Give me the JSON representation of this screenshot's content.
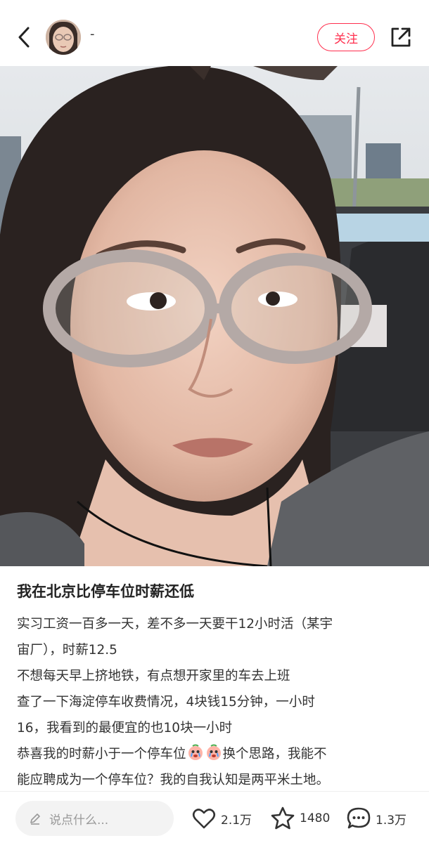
{
  "header": {
    "username": "-",
    "follow_label": "关注"
  },
  "post": {
    "title": "我在北京比停车位时薪还低",
    "lines": [
      "实习工资一百多一天，差不多一天要干12小时活（某宇",
      "宙厂），时薪12.5",
      "不想每天早上挤地铁，有点想开家里的车去上班",
      "查了一下海淀停车收费情况，4块钱15分钟，一小时",
      "16，我看到的最便宜的也10块一小时",
      "恭喜我的时薪小于一个停车位",
      "换个思路，我能不",
      "能应聘成为一个停车位？我的自我认知是两平米土地。"
    ],
    "emojis": [
      "crying-face-emoji",
      "crying-face-emoji"
    ]
  },
  "footer": {
    "comment_placeholder": "说点什么...",
    "likes": "2.1万",
    "stars": "1480",
    "comments": "1.3万"
  },
  "icons": {
    "back": "chevron-left-icon",
    "share": "share-icon",
    "like": "heart-icon",
    "star": "star-icon",
    "comment": "comment-bubble-icon",
    "pen": "pen-icon"
  },
  "colors": {
    "accent": "#ff2e4d",
    "text": "#222222",
    "muted": "#999999",
    "input_bg": "#f3f3f3"
  }
}
